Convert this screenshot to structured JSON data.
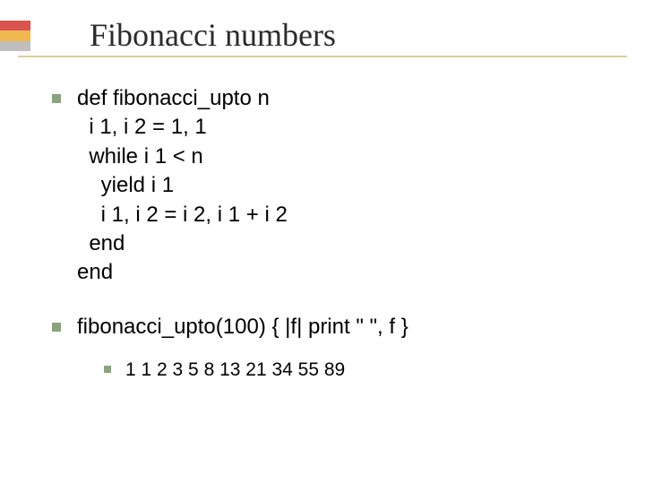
{
  "title": "Fibonacci numbers",
  "code": {
    "l1": "def fibonacci_upto n",
    "l2": "  i 1, i 2 = 1, 1",
    "l3": "  while i 1 < n",
    "l4": "    yield i 1",
    "l5": "    i 1, i 2 = i 2, i 1 + i 2",
    "l6": "  end",
    "l7": "end"
  },
  "call_line": "fibonacci_upto(100) { |f| print \" \", f }",
  "output": "1 1 2 3 5 8 13 21 34 55 89"
}
